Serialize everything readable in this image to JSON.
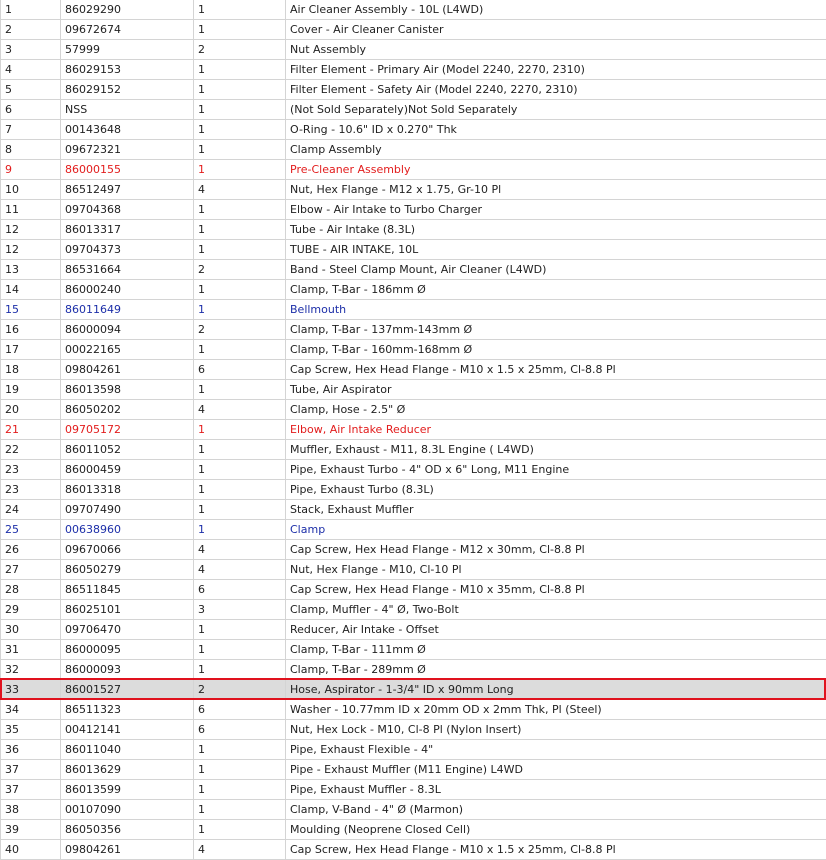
{
  "colors": {
    "red_row": "#e21c1c",
    "blue_row": "#1c2ea8",
    "selected_background": "#dcdcdc",
    "selection_outline": "#e0121e"
  },
  "rows": [
    {
      "ref": "1",
      "part": "86029290",
      "qty": "1",
      "desc": "Air Cleaner Assembly - 10L (L4WD)",
      "style": ""
    },
    {
      "ref": "2",
      "part": "09672674",
      "qty": "1",
      "desc": "Cover - Air Cleaner Canister",
      "style": ""
    },
    {
      "ref": "3",
      "part": "57999",
      "qty": "2",
      "desc": "Nut Assembly",
      "style": ""
    },
    {
      "ref": "4",
      "part": "86029153",
      "qty": "1",
      "desc": "Filter Element - Primary Air (Model 2240, 2270, 2310)",
      "style": ""
    },
    {
      "ref": "5",
      "part": "86029152",
      "qty": "1",
      "desc": "Filter Element - Safety Air (Model 2240, 2270, 2310)",
      "style": ""
    },
    {
      "ref": "6",
      "part": "NSS",
      "qty": "1",
      "desc": "(Not Sold Separately)Not Sold Separately",
      "style": ""
    },
    {
      "ref": "7",
      "part": "00143648",
      "qty": "1",
      "desc": "O-Ring - 10.6\" ID x 0.270\" Thk",
      "style": ""
    },
    {
      "ref": "8",
      "part": "09672321",
      "qty": "1",
      "desc": "Clamp Assembly",
      "style": ""
    },
    {
      "ref": "9",
      "part": "86000155",
      "qty": "1",
      "desc": "Pre-Cleaner Assembly",
      "style": "red"
    },
    {
      "ref": "10",
      "part": "86512497",
      "qty": "4",
      "desc": "Nut, Hex Flange - M12 x 1.75, Gr-10 Pl",
      "style": ""
    },
    {
      "ref": "11",
      "part": "09704368",
      "qty": "1",
      "desc": "Elbow - Air Intake to Turbo Charger",
      "style": ""
    },
    {
      "ref": "12",
      "part": "86013317",
      "qty": "1",
      "desc": "Tube - Air Intake (8.3L)",
      "style": ""
    },
    {
      "ref": "12",
      "part": "09704373",
      "qty": "1",
      "desc": "TUBE - AIR INTAKE, 10L",
      "style": ""
    },
    {
      "ref": "13",
      "part": "86531664",
      "qty": "2",
      "desc": "Band - Steel Clamp Mount, Air Cleaner (L4WD)",
      "style": ""
    },
    {
      "ref": "14",
      "part": "86000240",
      "qty": "1",
      "desc": "Clamp, T-Bar - 186mm Ø",
      "style": ""
    },
    {
      "ref": "15",
      "part": "86011649",
      "qty": "1",
      "desc": "Bellmouth",
      "style": "blue"
    },
    {
      "ref": "16",
      "part": "86000094",
      "qty": "2",
      "desc": "Clamp, T-Bar - 137mm-143mm Ø",
      "style": ""
    },
    {
      "ref": "17",
      "part": "00022165",
      "qty": "1",
      "desc": "Clamp, T-Bar - 160mm-168mm Ø",
      "style": ""
    },
    {
      "ref": "18",
      "part": "09804261",
      "qty": "6",
      "desc": "Cap Screw, Hex Head Flange - M10 x 1.5 x 25mm, Cl-8.8 Pl",
      "style": ""
    },
    {
      "ref": "19",
      "part": "86013598",
      "qty": "1",
      "desc": "Tube, Air Aspirator",
      "style": ""
    },
    {
      "ref": "20",
      "part": "86050202",
      "qty": "4",
      "desc": "Clamp, Hose - 2.5\" Ø",
      "style": ""
    },
    {
      "ref": "21",
      "part": "09705172",
      "qty": "1",
      "desc": "Elbow, Air Intake Reducer",
      "style": "red"
    },
    {
      "ref": "22",
      "part": "86011052",
      "qty": "1",
      "desc": "Muffler, Exhaust - M11, 8.3L Engine ( L4WD)",
      "style": ""
    },
    {
      "ref": "23",
      "part": "86000459",
      "qty": "1",
      "desc": "Pipe, Exhaust Turbo - 4\" OD x 6\" Long, M11 Engine",
      "style": ""
    },
    {
      "ref": "23",
      "part": "86013318",
      "qty": "1",
      "desc": "Pipe, Exhaust Turbo (8.3L)",
      "style": ""
    },
    {
      "ref": "24",
      "part": "09707490",
      "qty": "1",
      "desc": "Stack, Exhaust Muffler",
      "style": ""
    },
    {
      "ref": "25",
      "part": "00638960",
      "qty": "1",
      "desc": "Clamp",
      "style": "blue"
    },
    {
      "ref": "26",
      "part": "09670066",
      "qty": "4",
      "desc": "Cap Screw, Hex Head Flange - M12 x 30mm, Cl-8.8 Pl",
      "style": ""
    },
    {
      "ref": "27",
      "part": "86050279",
      "qty": "4",
      "desc": "Nut, Hex Flange - M10, Cl-10 Pl",
      "style": ""
    },
    {
      "ref": "28",
      "part": "86511845",
      "qty": "6",
      "desc": "Cap Screw, Hex Head Flange - M10 x 35mm, Cl-8.8 Pl",
      "style": ""
    },
    {
      "ref": "29",
      "part": "86025101",
      "qty": "3",
      "desc": "Clamp, Muffler - 4\" Ø, Two-Bolt",
      "style": ""
    },
    {
      "ref": "30",
      "part": "09706470",
      "qty": "1",
      "desc": "Reducer, Air Intake - Offset",
      "style": ""
    },
    {
      "ref": "31",
      "part": "86000095",
      "qty": "1",
      "desc": "Clamp, T-Bar - 111mm Ø",
      "style": ""
    },
    {
      "ref": "32",
      "part": "86000093",
      "qty": "1",
      "desc": "Clamp, T-Bar - 289mm Ø",
      "style": ""
    },
    {
      "ref": "33",
      "part": "86001527",
      "qty": "2",
      "desc": "Hose, Aspirator - 1-3/4\" ID x 90mm Long",
      "style": "selected"
    },
    {
      "ref": "34",
      "part": "86511323",
      "qty": "6",
      "desc": "Washer - 10.77mm ID x 20mm OD x 2mm Thk, Pl (Steel)",
      "style": ""
    },
    {
      "ref": "35",
      "part": "00412141",
      "qty": "6",
      "desc": "Nut, Hex Lock - M10, Cl-8 Pl (Nylon Insert)",
      "style": ""
    },
    {
      "ref": "36",
      "part": "86011040",
      "qty": "1",
      "desc": "Pipe, Exhaust Flexible - 4\"",
      "style": ""
    },
    {
      "ref": "37",
      "part": "86013629",
      "qty": "1",
      "desc": "Pipe - Exhaust Muffler (M11 Engine) L4WD",
      "style": ""
    },
    {
      "ref": "37",
      "part": "86013599",
      "qty": "1",
      "desc": "Pipe, Exhaust Muffler - 8.3L",
      "style": ""
    },
    {
      "ref": "38",
      "part": "00107090",
      "qty": "1",
      "desc": "Clamp, V-Band - 4\" Ø (Marmon)",
      "style": ""
    },
    {
      "ref": "39",
      "part": "86050356",
      "qty": "1",
      "desc": "Moulding (Neoprene Closed Cell)",
      "style": ""
    },
    {
      "ref": "40",
      "part": "09804261",
      "qty": "4",
      "desc": "Cap Screw, Hex Head Flange - M10 x 1.5 x 25mm, Cl-8.8 Pl",
      "style": ""
    }
  ]
}
